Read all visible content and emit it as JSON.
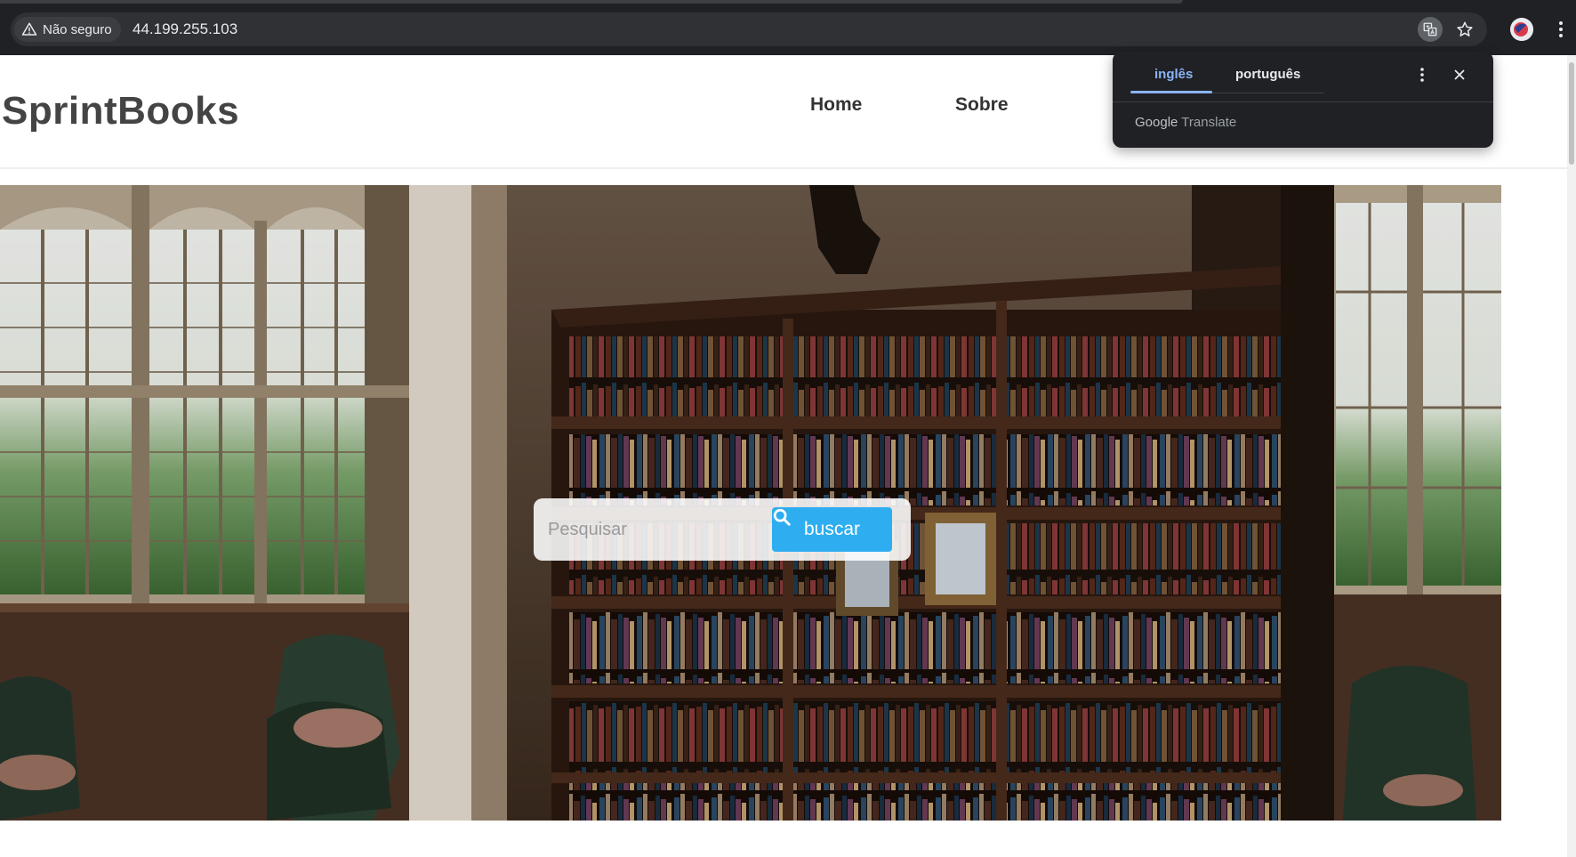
{
  "browser": {
    "security_label": "Não seguro",
    "url": "44.199.255.103",
    "icons": [
      "warning-icon",
      "translate-icon",
      "star-icon",
      "profile-avatar",
      "kebab-menu-icon"
    ]
  },
  "site": {
    "logo": "SprintBooks",
    "nav": [
      {
        "label": "Home"
      },
      {
        "label": "Sobre"
      }
    ]
  },
  "search": {
    "placeholder": "Pesquisar",
    "button_label": "buscar"
  },
  "translate_popup": {
    "tabs": [
      "inglês",
      "português"
    ],
    "active_tab": "inglês",
    "footer_brand": "Google",
    "footer_product": "Translate"
  },
  "colors": {
    "browser_chrome": "#202124",
    "accent_button": "#2eaef0",
    "translate_active": "#8ab4f8",
    "logo_text": "#444444"
  }
}
